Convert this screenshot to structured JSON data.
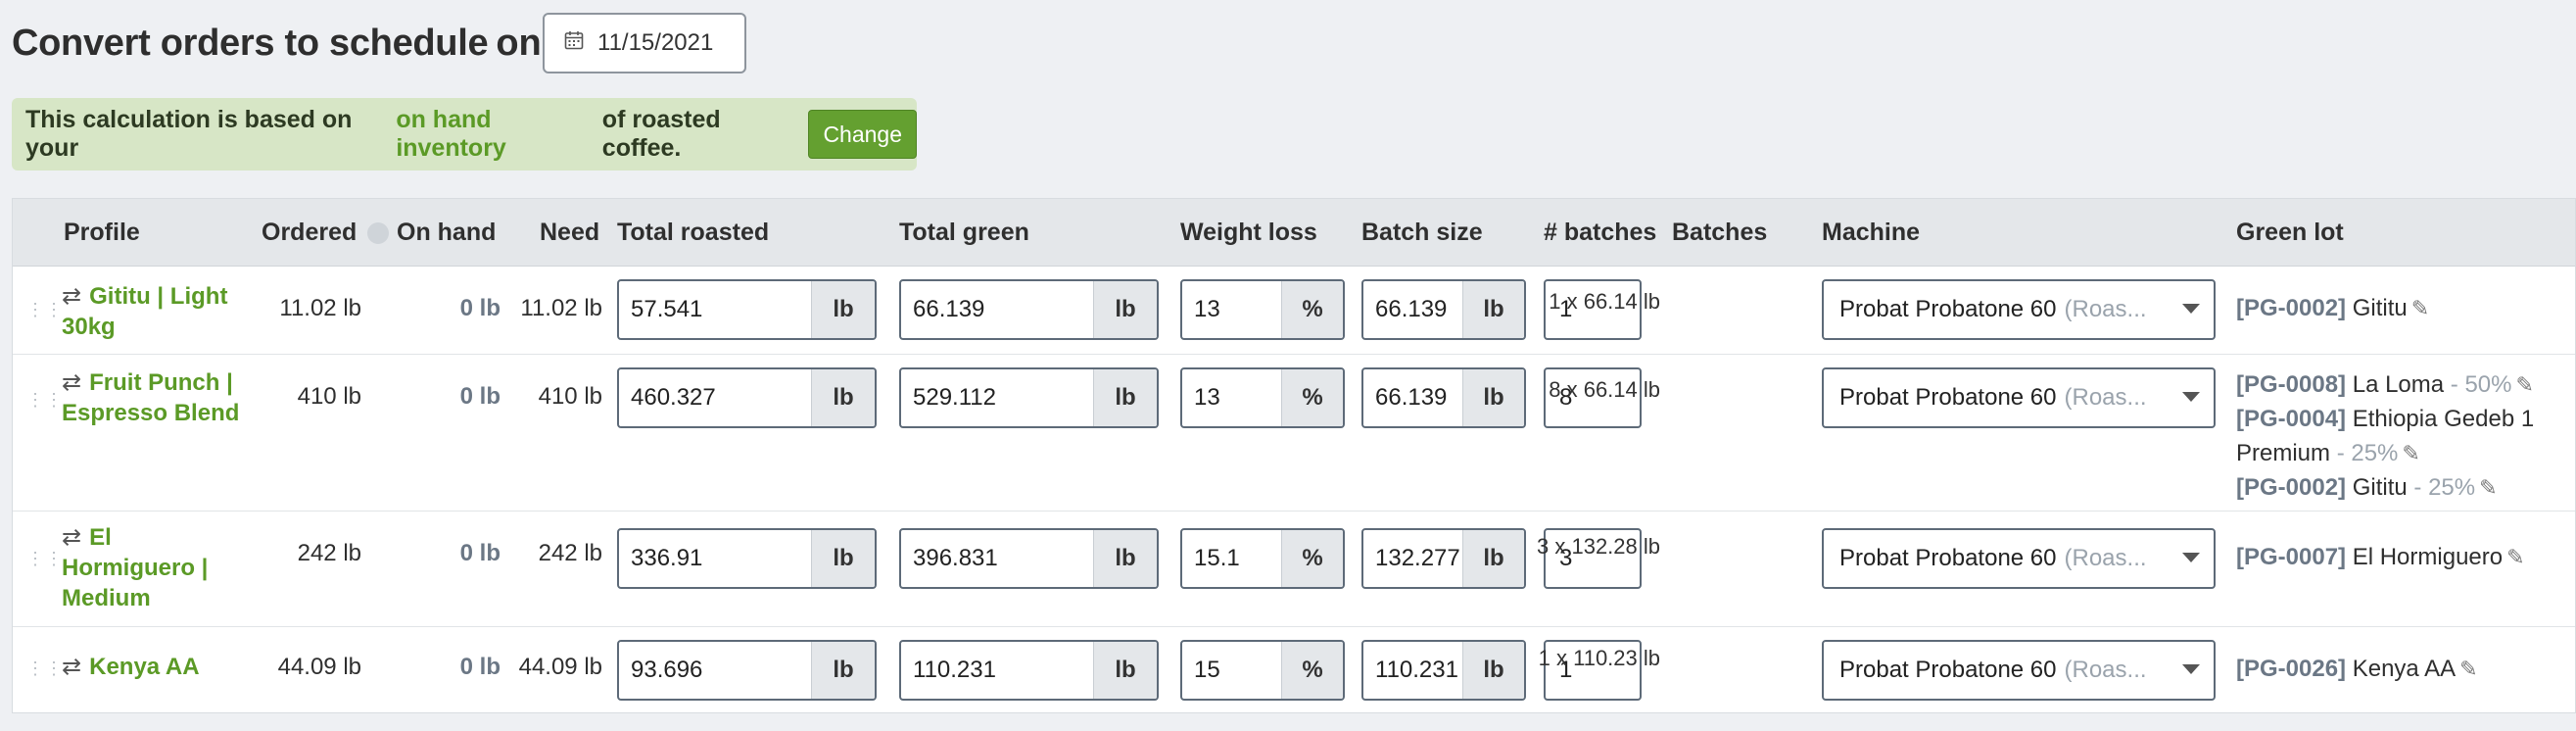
{
  "header": {
    "title": "Convert orders to schedule",
    "on_label": "on",
    "date": "11/15/2021"
  },
  "notice": {
    "prefix": "This calculation is based on your",
    "link": "on hand inventory",
    "suffix": "of roasted coffee.",
    "change_label": "Change"
  },
  "table": {
    "columns": {
      "profile": "Profile",
      "ordered": "Ordered",
      "on_hand": "On hand",
      "need": "Need",
      "total_roasted": "Total roasted",
      "total_green": "Total green",
      "weight_loss": "Weight loss",
      "batch_size": "Batch size",
      "num_batches": "# batches",
      "batches": "Batches",
      "machine": "Machine",
      "green_lot": "Green lot"
    },
    "units": {
      "lb": "lb",
      "pct": "%"
    },
    "rows": [
      {
        "profile": "Gititu | Light 30kg",
        "ordered": "11.02 lb",
        "on_hand": "0 lb",
        "need": "11.02 lb",
        "total_roasted": "57.541",
        "total_green": "66.139",
        "weight_loss": "13",
        "batch_size": "66.139",
        "num_batches": "1",
        "batches": "1 x 66.14 lb",
        "machine": "Probat Probatone 60",
        "machine_note": "(Roas...",
        "lots": [
          {
            "code": "[PG-0002]",
            "name": "Gititu",
            "pct": ""
          }
        ]
      },
      {
        "profile": "Fruit Punch | Espresso Blend",
        "ordered": "410 lb",
        "on_hand": "0 lb",
        "need": "410 lb",
        "total_roasted": "460.327",
        "total_green": "529.112",
        "weight_loss": "13",
        "batch_size": "66.139",
        "num_batches": "8",
        "batches": "8 x 66.14 lb",
        "machine": "Probat Probatone 60",
        "machine_note": "(Roas...",
        "lots": [
          {
            "code": "[PG-0008]",
            "name": "La Loma",
            "pct": "- 50%"
          },
          {
            "code": "[PG-0004]",
            "name": "Ethiopia Gedeb 1",
            "name2": "Premium",
            "pct": "- 25%"
          },
          {
            "code": "[PG-0002]",
            "name": "Gititu",
            "pct": "- 25%"
          }
        ]
      },
      {
        "profile": "El Hormiguero | Medium",
        "ordered": "242 lb",
        "on_hand": "0 lb",
        "need": "242 lb",
        "total_roasted": "336.91",
        "total_green": "396.831",
        "weight_loss": "15.1",
        "batch_size": "132.277",
        "num_batches": "3",
        "batches": "3 x 132.28 lb",
        "machine": "Probat Probatone 60",
        "machine_note": "(Roas...",
        "lots": [
          {
            "code": "[PG-0007]",
            "name": "El Hormiguero",
            "pct": ""
          }
        ]
      },
      {
        "profile": "Kenya AA",
        "ordered": "44.09 lb",
        "on_hand": "0 lb",
        "need": "44.09 lb",
        "total_roasted": "93.696",
        "total_green": "110.231",
        "weight_loss": "15",
        "batch_size": "110.231",
        "num_batches": "1",
        "batches": "1 x 110.23 lb",
        "machine": "Probat Probatone 60",
        "machine_note": "(Roas...",
        "lots": [
          {
            "code": "[PG-0026]",
            "name": "Kenya AA",
            "pct": ""
          }
        ]
      }
    ]
  },
  "icons": {
    "calendar": "calendar-icon",
    "swap": "swap-arrows-icon",
    "drag": "drag-handle-icon",
    "info": "info-icon",
    "caret": "chevron-down-icon",
    "edit": "pencil-icon"
  },
  "colors": {
    "accent_green": "#5b9a26",
    "notice_bg": "#d7e6c6",
    "button_green": "#64a030",
    "lot_code_gray": "#6b7785"
  }
}
